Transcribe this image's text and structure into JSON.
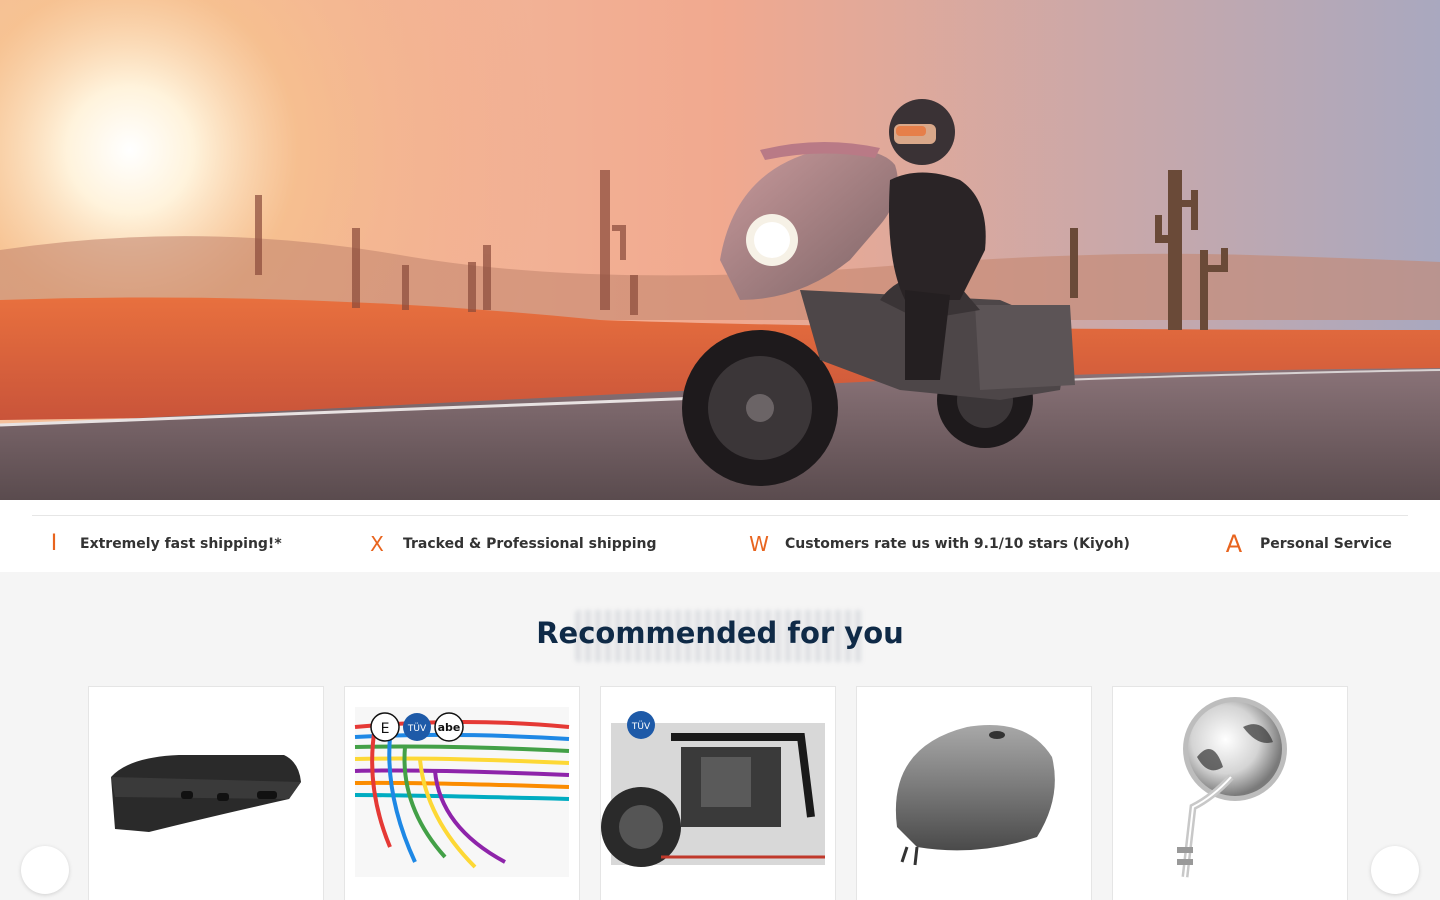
{
  "hero": {
    "scene": "motorcycle-rider-desert-sunset"
  },
  "usp": {
    "items": [
      {
        "icon": "lightning-icon",
        "glyph": "I",
        "text": "Extremely fast shipping!*"
      },
      {
        "icon": "truck-icon",
        "glyph": "X",
        "text": "Tracked & Professional shipping"
      },
      {
        "icon": "star-icon",
        "glyph": "W",
        "text": "Customers rate us with 9.1/10 stars (Kiyoh)"
      },
      {
        "icon": "person-icon",
        "glyph": "A",
        "text": "Personal Service"
      }
    ]
  },
  "recommended": {
    "title": "Recommended for you",
    "products": [
      {
        "image": "black-tail-light-housing"
      },
      {
        "image": "colored-wiring-harness",
        "badges": [
          "E",
          "TÜV",
          "abe"
        ]
      },
      {
        "image": "engine-guard-crash-bar",
        "badges": [
          "TÜV"
        ]
      },
      {
        "image": "raw-steel-fuel-tank"
      },
      {
        "image": "chrome-round-mirror"
      }
    ],
    "prev_icon": "chevron-left-icon",
    "next_icon": "chevron-right-icon",
    "prev_glyph": "",
    "next_glyph": ""
  },
  "colors": {
    "accent": "#e8641e",
    "title": "#0f2a47",
    "text": "#333333",
    "background": "#f5f5f5"
  }
}
